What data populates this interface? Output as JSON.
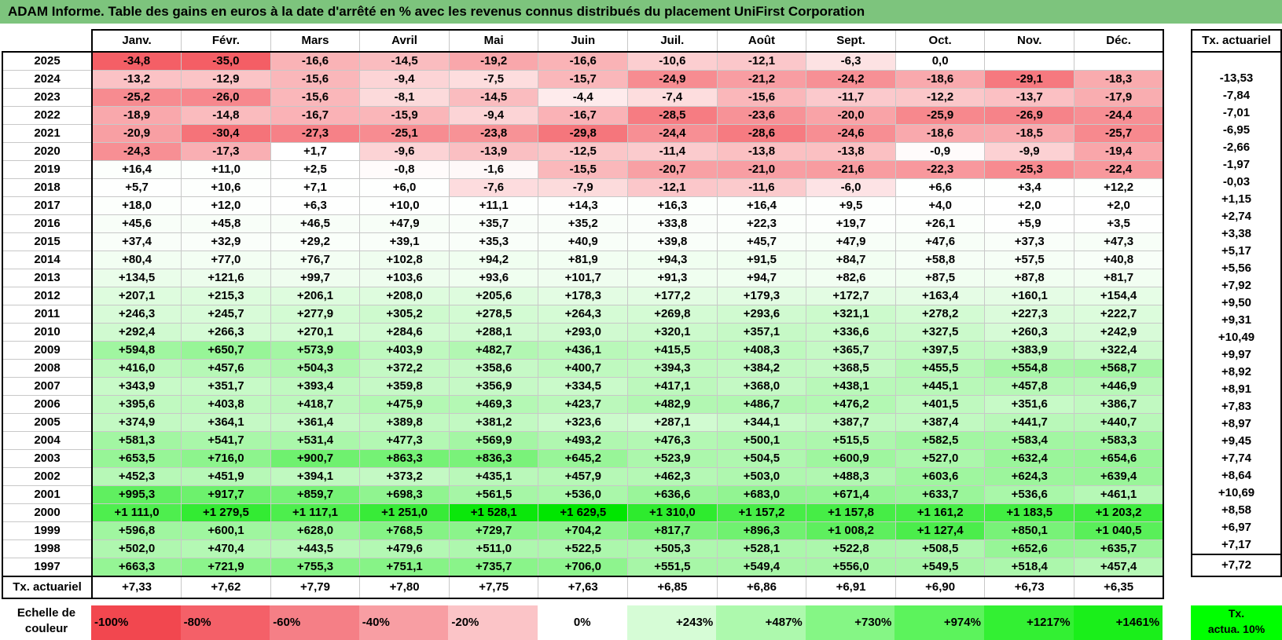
{
  "title": "ADAM Informe. Table des gains en euros à la date d'arrêté en % avec les revenus connus distribués du placement UniFirst Corporation",
  "months": [
    "Janv.",
    "Févr.",
    "Mars",
    "Avril",
    "Mai",
    "Juin",
    "Juil.",
    "Août",
    "Sept.",
    "Oct.",
    "Nov.",
    "Déc."
  ],
  "tx_header": "Tx. actuariel",
  "rows": [
    {
      "year": "2025",
      "values": [
        "-34,8",
        "-35,0",
        "-16,6",
        "-14,5",
        "-19,2",
        "-16,6",
        "-10,6",
        "-12,1",
        "-6,3",
        "0,0",
        "",
        ""
      ],
      "tx": ""
    },
    {
      "year": "2024",
      "values": [
        "-13,2",
        "-12,9",
        "-15,6",
        "-9,4",
        "-7,5",
        "-15,7",
        "-24,9",
        "-21,2",
        "-24,2",
        "-18,6",
        "-29,1",
        "-18,3"
      ],
      "tx": "-13,53"
    },
    {
      "year": "2023",
      "values": [
        "-25,2",
        "-26,0",
        "-15,6",
        "-8,1",
        "-14,5",
        "-4,4",
        "-7,4",
        "-15,6",
        "-11,7",
        "-12,2",
        "-13,7",
        "-17,9"
      ],
      "tx": "-7,84"
    },
    {
      "year": "2022",
      "values": [
        "-18,9",
        "-14,8",
        "-16,7",
        "-15,9",
        "-9,4",
        "-16,7",
        "-28,5",
        "-23,6",
        "-20,0",
        "-25,9",
        "-26,9",
        "-24,4"
      ],
      "tx": "-7,01"
    },
    {
      "year": "2021",
      "values": [
        "-20,9",
        "-30,4",
        "-27,3",
        "-25,1",
        "-23,8",
        "-29,8",
        "-24,4",
        "-28,6",
        "-24,6",
        "-18,6",
        "-18,5",
        "-25,7"
      ],
      "tx": "-6,95"
    },
    {
      "year": "2020",
      "values": [
        "-24,3",
        "-17,3",
        "+1,7",
        "-9,6",
        "-13,9",
        "-12,5",
        "-11,4",
        "-13,8",
        "-13,8",
        "-0,9",
        "-9,9",
        "-19,4"
      ],
      "tx": "-2,66"
    },
    {
      "year": "2019",
      "values": [
        "+16,4",
        "+11,0",
        "+2,5",
        "-0,8",
        "-1,6",
        "-15,5",
        "-20,7",
        "-21,0",
        "-21,6",
        "-22,3",
        "-25,3",
        "-22,4"
      ],
      "tx": "-1,97"
    },
    {
      "year": "2018",
      "values": [
        "+5,7",
        "+10,6",
        "+7,1",
        "+6,0",
        "-7,6",
        "-7,9",
        "-12,1",
        "-11,6",
        "-6,0",
        "+6,6",
        "+3,4",
        "+12,2"
      ],
      "tx": "-0,03"
    },
    {
      "year": "2017",
      "values": [
        "+18,0",
        "+12,0",
        "+6,3",
        "+10,0",
        "+11,1",
        "+14,3",
        "+16,3",
        "+16,4",
        "+9,5",
        "+4,0",
        "+2,0",
        "+2,0"
      ],
      "tx": "+1,15"
    },
    {
      "year": "2016",
      "values": [
        "+45,6",
        "+45,8",
        "+46,5",
        "+47,9",
        "+35,7",
        "+35,2",
        "+33,8",
        "+22,3",
        "+19,7",
        "+26,1",
        "+5,9",
        "+3,5"
      ],
      "tx": "+2,74"
    },
    {
      "year": "2015",
      "values": [
        "+37,4",
        "+32,9",
        "+29,2",
        "+39,1",
        "+35,3",
        "+40,9",
        "+39,8",
        "+45,7",
        "+47,9",
        "+47,6",
        "+37,3",
        "+47,3"
      ],
      "tx": "+3,38"
    },
    {
      "year": "2014",
      "values": [
        "+80,4",
        "+77,0",
        "+76,7",
        "+102,8",
        "+94,2",
        "+81,9",
        "+94,3",
        "+91,5",
        "+84,7",
        "+58,8",
        "+57,5",
        "+40,8"
      ],
      "tx": "+5,17"
    },
    {
      "year": "2013",
      "values": [
        "+134,5",
        "+121,6",
        "+99,7",
        "+103,6",
        "+93,6",
        "+101,7",
        "+91,3",
        "+94,7",
        "+82,6",
        "+87,5",
        "+87,8",
        "+81,7"
      ],
      "tx": "+5,56"
    },
    {
      "year": "2012",
      "values": [
        "+207,1",
        "+215,3",
        "+206,1",
        "+208,0",
        "+205,6",
        "+178,3",
        "+177,2",
        "+179,3",
        "+172,7",
        "+163,4",
        "+160,1",
        "+154,4"
      ],
      "tx": "+7,92"
    },
    {
      "year": "2011",
      "values": [
        "+246,3",
        "+245,7",
        "+277,9",
        "+305,2",
        "+278,5",
        "+264,3",
        "+269,8",
        "+293,6",
        "+321,1",
        "+278,2",
        "+227,3",
        "+222,7"
      ],
      "tx": "+9,50"
    },
    {
      "year": "2010",
      "values": [
        "+292,4",
        "+266,3",
        "+270,1",
        "+284,6",
        "+288,1",
        "+293,0",
        "+320,1",
        "+357,1",
        "+336,6",
        "+327,5",
        "+260,3",
        "+242,9"
      ],
      "tx": "+9,31"
    },
    {
      "year": "2009",
      "values": [
        "+594,8",
        "+650,7",
        "+573,9",
        "+403,9",
        "+482,7",
        "+436,1",
        "+415,5",
        "+408,3",
        "+365,7",
        "+397,5",
        "+383,9",
        "+322,4"
      ],
      "tx": "+10,49"
    },
    {
      "year": "2008",
      "values": [
        "+416,0",
        "+457,6",
        "+504,3",
        "+372,2",
        "+358,6",
        "+400,7",
        "+394,3",
        "+384,2",
        "+368,5",
        "+455,5",
        "+554,8",
        "+568,7"
      ],
      "tx": "+9,97"
    },
    {
      "year": "2007",
      "values": [
        "+343,9",
        "+351,7",
        "+393,4",
        "+359,8",
        "+356,9",
        "+334,5",
        "+417,1",
        "+368,0",
        "+438,1",
        "+445,1",
        "+457,8",
        "+446,9"
      ],
      "tx": "+8,92"
    },
    {
      "year": "2006",
      "values": [
        "+395,6",
        "+403,8",
        "+418,7",
        "+475,9",
        "+469,3",
        "+423,7",
        "+482,9",
        "+486,7",
        "+476,2",
        "+401,5",
        "+351,6",
        "+386,7"
      ],
      "tx": "+8,91"
    },
    {
      "year": "2005",
      "values": [
        "+374,9",
        "+364,1",
        "+361,4",
        "+389,8",
        "+381,2",
        "+323,6",
        "+287,1",
        "+344,1",
        "+387,7",
        "+387,4",
        "+441,7",
        "+440,7"
      ],
      "tx": "+7,83"
    },
    {
      "year": "2004",
      "values": [
        "+581,3",
        "+541,7",
        "+531,4",
        "+477,3",
        "+569,9",
        "+493,2",
        "+476,3",
        "+500,1",
        "+515,5",
        "+582,5",
        "+583,4",
        "+583,3"
      ],
      "tx": "+8,97"
    },
    {
      "year": "2003",
      "values": [
        "+653,5",
        "+716,0",
        "+900,7",
        "+863,3",
        "+836,3",
        "+645,2",
        "+523,9",
        "+504,5",
        "+600,9",
        "+527,0",
        "+632,4",
        "+654,6"
      ],
      "tx": "+9,45"
    },
    {
      "year": "2002",
      "values": [
        "+452,3",
        "+451,9",
        "+394,1",
        "+373,2",
        "+435,1",
        "+457,9",
        "+462,3",
        "+503,0",
        "+488,3",
        "+603,6",
        "+624,3",
        "+639,4"
      ],
      "tx": "+7,74"
    },
    {
      "year": "2001",
      "values": [
        "+995,3",
        "+917,7",
        "+859,7",
        "+698,3",
        "+561,5",
        "+536,0",
        "+636,6",
        "+683,0",
        "+671,4",
        "+633,7",
        "+536,6",
        "+461,1"
      ],
      "tx": "+8,64"
    },
    {
      "year": "2000",
      "values": [
        "+1 111,0",
        "+1 279,5",
        "+1 117,1",
        "+1 251,0",
        "+1 528,1",
        "+1 629,5",
        "+1 310,0",
        "+1 157,2",
        "+1 157,8",
        "+1 161,2",
        "+1 183,5",
        "+1 203,2"
      ],
      "tx": "+10,69"
    },
    {
      "year": "1999",
      "values": [
        "+596,8",
        "+600,1",
        "+628,0",
        "+768,5",
        "+729,7",
        "+704,2",
        "+817,7",
        "+896,3",
        "+1 008,2",
        "+1 127,4",
        "+850,1",
        "+1 040,5"
      ],
      "tx": "+8,58"
    },
    {
      "year": "1998",
      "values": [
        "+502,0",
        "+470,4",
        "+443,5",
        "+479,6",
        "+511,0",
        "+522,5",
        "+505,3",
        "+528,1",
        "+522,8",
        "+508,5",
        "+652,6",
        "+635,7"
      ],
      "tx": "+6,97"
    },
    {
      "year": "1997",
      "values": [
        "+663,3",
        "+721,9",
        "+755,3",
        "+751,1",
        "+735,7",
        "+706,0",
        "+551,5",
        "+549,4",
        "+556,0",
        "+549,5",
        "+518,4",
        "+457,4"
      ],
      "tx": "+7,17"
    }
  ],
  "footer": {
    "label": "Tx. actuariel",
    "values": [
      "+7,33",
      "+7,62",
      "+7,79",
      "+7,80",
      "+7,75",
      "+7,63",
      "+6,85",
      "+6,86",
      "+6,91",
      "+6,90",
      "+6,73",
      "+6,35"
    ],
    "tx": "+7,72"
  },
  "scale": {
    "label_line1": "Echelle de",
    "label_line2": "couleur",
    "swatches": [
      {
        "label": "-100%",
        "color": "#f2474f"
      },
      {
        "label": "-80%",
        "color": "#f46068"
      },
      {
        "label": "-60%",
        "color": "#f57f86"
      },
      {
        "label": "-40%",
        "color": "#f89ea3"
      },
      {
        "label": "-20%",
        "color": "#fbc4c7"
      },
      {
        "label": "0%",
        "color": "#ffffff"
      },
      {
        "label": "+243%",
        "color": "#d6fcd6"
      },
      {
        "label": "+487%",
        "color": "#adf9ad"
      },
      {
        "label": "+730%",
        "color": "#85f685"
      },
      {
        "label": "+974%",
        "color": "#5cf35c"
      },
      {
        "label": "+1217%",
        "color": "#33f033"
      },
      {
        "label": "+1461%",
        "color": "#1aef1a"
      }
    ],
    "tx_line1": "Tx.",
    "tx_line2": "actua. 10%",
    "tx_color": "#00ff00"
  },
  "colors": {
    "title_bg": "#7dc47d",
    "neg_max": "#f2474f",
    "pos_max": "#00e600"
  }
}
